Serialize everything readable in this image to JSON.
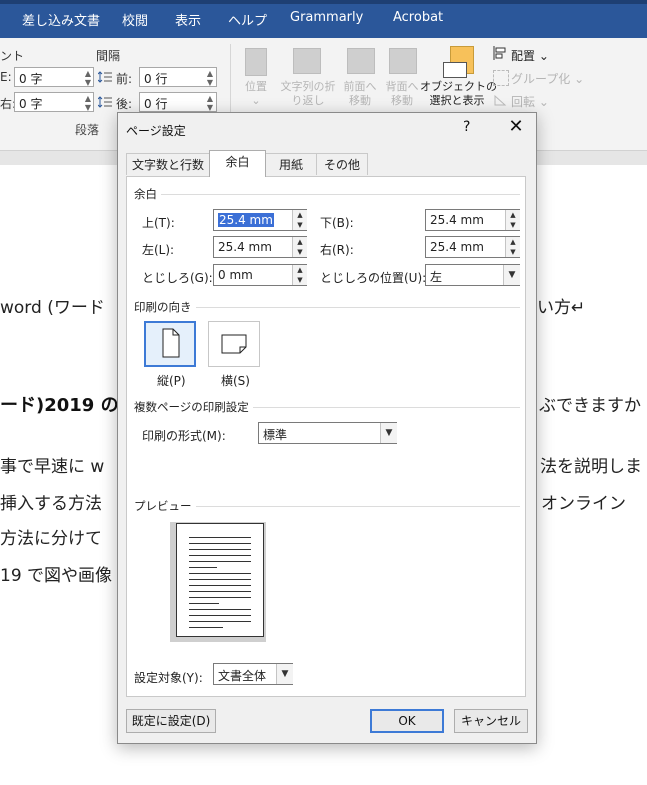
{
  "ribbon": {
    "tabs": [
      "差し込み文書",
      "校閲",
      "表示",
      "ヘルプ",
      "Grammarly",
      "Acrobat"
    ],
    "paragraph": {
      "indent_label": "ント",
      "spacing_label": "間隔",
      "left_prefix": "E:",
      "right_prefix": "右:",
      "left_value": "0 字",
      "right_value": "0 字",
      "before_label": "前:",
      "after_label": "後:",
      "before_value": "0 行",
      "after_value": "0 行",
      "group_label": "段落"
    },
    "arrange": {
      "position": "位置",
      "wrap_text_1": "文字列の折",
      "wrap_text_2": "り返し",
      "bring_forward_1": "前面へ",
      "bring_forward_2": "移動",
      "send_backward_1": "背面へ",
      "send_backward_2": "移動",
      "selection_pane_1": "オブジェクトの",
      "selection_pane_2": "選択と表示",
      "align": "配置",
      "group": "グループ化",
      "rotate": "回転"
    }
  },
  "document": {
    "line1": "word (ワード",
    "line1_right": "い方↵",
    "line2_bold": "ード)2019 の",
    "line2_right": "ぶできますか",
    "line3": "事で早速に w",
    "line3_right": "法を説明しま",
    "line4": "挿入する方法",
    "line4_right": "オンライン",
    "line5": "方法に分けて",
    "line6": "19 で図や画像"
  },
  "dialog": {
    "title": "ページ設定",
    "help": "?",
    "close": "✕",
    "tabs": [
      "文字数と行数",
      "余白",
      "用紙",
      "その他"
    ],
    "active_tab": "余白",
    "margins_section": "余白",
    "top_label": "上(T):",
    "top_value": "25.4 mm",
    "bottom_label": "下(B):",
    "bottom_value": "25.4 mm",
    "left_label": "左(L):",
    "left_value": "25.4 mm",
    "right_label": "右(R):",
    "right_value": "25.4 mm",
    "gutter_label": "とじしろ(G):",
    "gutter_value": "0 mm",
    "gutter_pos_label": "とじしろの位置(U):",
    "gutter_pos_value": "左",
    "orientation_section": "印刷の向き",
    "portrait": "縦(P)",
    "landscape": "横(S)",
    "pages_section": "複数ページの印刷設定",
    "multiple_pages_label": "印刷の形式(M):",
    "multiple_pages_value": "標準",
    "preview_section": "プレビュー",
    "apply_to_label": "設定対象(Y):",
    "apply_to_value": "文書全体",
    "default_button": "既定に設定(D)",
    "ok_button": "OK",
    "cancel_button": "キャンセル"
  },
  "colors": {
    "ribbon": "#2b579a",
    "accent": "#3d7ad6",
    "selection": "#3b6fd6"
  }
}
